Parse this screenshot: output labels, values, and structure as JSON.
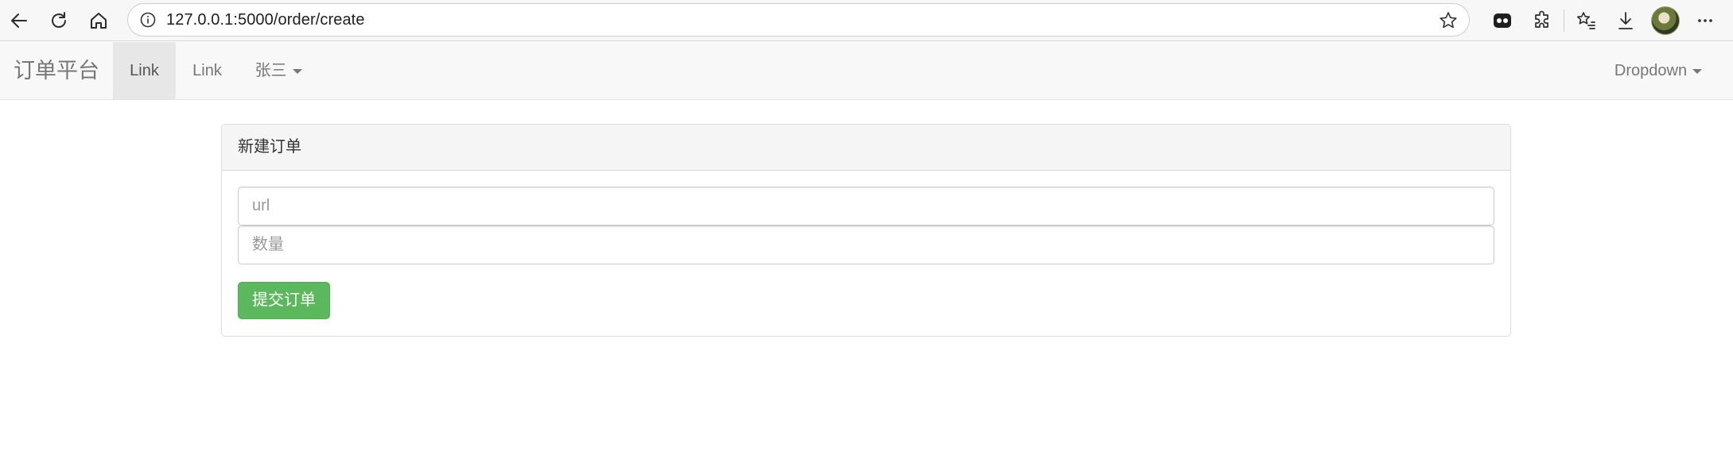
{
  "browser": {
    "url": "127.0.0.1:5000/order/create"
  },
  "navbar": {
    "brand": "订单平台",
    "items": [
      {
        "label": "Link",
        "active": true
      },
      {
        "label": "Link",
        "active": false
      },
      {
        "label": "张三",
        "dropdown": true
      }
    ],
    "right_dropdown": "Dropdown"
  },
  "panel": {
    "title": "新建订单",
    "url_placeholder": "url",
    "quantity_placeholder": "数量",
    "submit_label": "提交订单"
  },
  "colors": {
    "success": "#5cb85c",
    "navbar_bg": "#f8f8f8",
    "panel_heading_bg": "#f5f5f5"
  }
}
